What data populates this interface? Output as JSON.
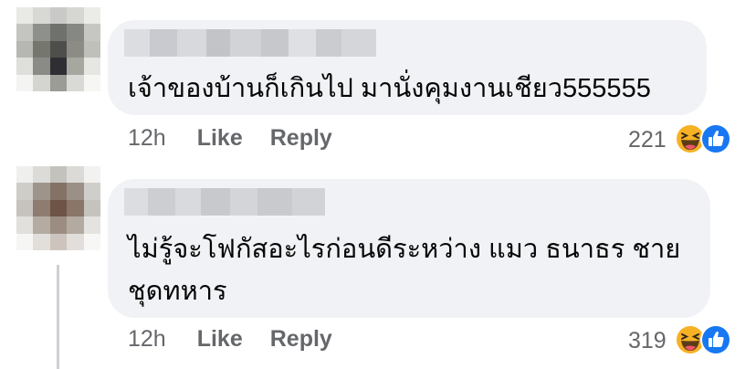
{
  "comments": [
    {
      "text_lines": [
        "เจ้าของบ้านก็เกินไป มานั่งคุมงานเชียว555555"
      ],
      "time": "12h",
      "like_label": "Like",
      "reply_label": "Reply",
      "reaction_count": "221",
      "reactions": [
        "haha-icon",
        "like-icon"
      ]
    },
    {
      "text_lines": [
        "ไม่รู้จะโฟกัสอะไรก่อนดีระหว่าง แมว ธนาธร ชาย",
        "ชุดทหาร"
      ],
      "time": "12h",
      "like_label": "Like",
      "reply_label": "Reply",
      "reaction_count": "319",
      "reactions": [
        "haha-icon",
        "like-icon"
      ]
    }
  ],
  "colors": {
    "bubble": "#f0f2f5",
    "meta_text": "#65676b",
    "like_blue": "#1877f2",
    "haha_yellow": "#f7b125"
  }
}
